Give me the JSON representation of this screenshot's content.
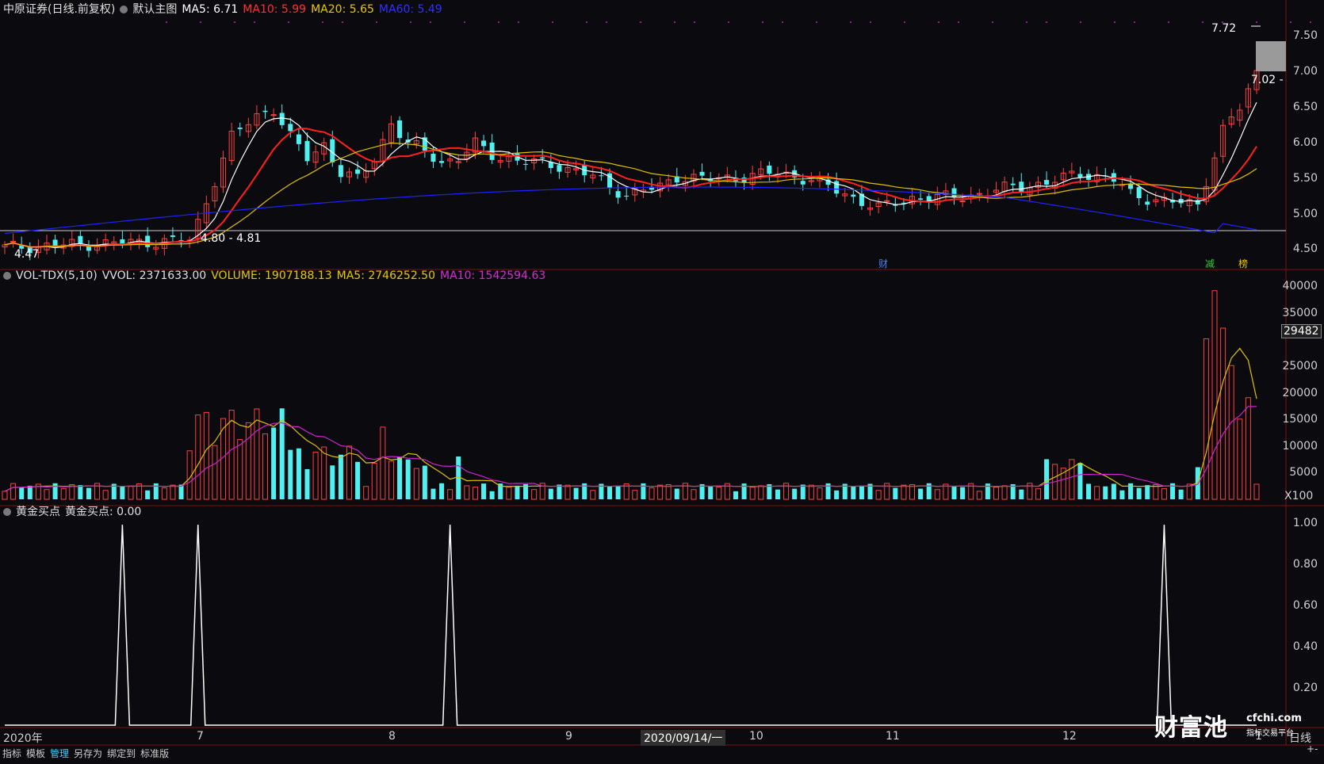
{
  "main_panel": {
    "stock_title": "中原证券(日线.前复权)",
    "template_name": "默认主图",
    "ma5": "MA5: 6.71",
    "ma10": "MA10: 5.99",
    "ma20": "MA20: 5.65",
    "ma60": "MA60: 5.49",
    "price_high_label": "7.72",
    "price_current_label": "7.02 -",
    "price_low_label": "4.47",
    "price_range_label": "4.80 - 4.81",
    "marker_cai": "财",
    "marker_jian": "减",
    "marker_bang": "榜",
    "y_ticks": [
      "7.50",
      "7.00",
      "6.50",
      "6.00",
      "5.50",
      "5.00",
      "4.50"
    ]
  },
  "volume_panel": {
    "title": "VOL-TDX(5,10)",
    "vvol": "VVOL: 2371633.00",
    "volume": "VOLUME: 1907188.13",
    "ma5": "MA5: 2746252.50",
    "ma10": "MA10: 1542594.63",
    "current_value_box": "29482",
    "unit": "X100",
    "y_ticks": [
      "40000",
      "35000",
      "25000",
      "20000",
      "15000",
      "10000",
      "5000"
    ]
  },
  "signal_panel": {
    "title": "黄金买点",
    "value": "黄金买点: 0.00",
    "y_ticks": [
      "1.00",
      "0.80",
      "0.60",
      "0.40",
      "0.20"
    ]
  },
  "x_axis": {
    "labels": [
      "2020年",
      "7",
      "8",
      "9",
      "10",
      "11",
      "12",
      "1"
    ],
    "cursor_date": "2020/09/14/一",
    "period": "日线",
    "zoom_plus": "+",
    "zoom_minus": "-"
  },
  "toolbar": {
    "items": [
      "指标",
      "模板",
      "管理",
      "另存为",
      "绑定到",
      "标准版"
    ],
    "active_index": 2
  },
  "watermark": {
    "brand": "财富池",
    "domain": "cfchi.com",
    "tagline": "指标交易平台"
  },
  "colors": {
    "background": "#0b0b0f",
    "up": "#ff4040",
    "down": "#50f0f0",
    "ma5": "#ffffff",
    "ma10": "#ff2020",
    "ma20": "#e0c000",
    "ma60": "#2020ff",
    "vol_ma5": "#e0c000",
    "vol_ma10": "#d020d0",
    "signal": "#ffffff",
    "grid": "#7a1010"
  }
}
